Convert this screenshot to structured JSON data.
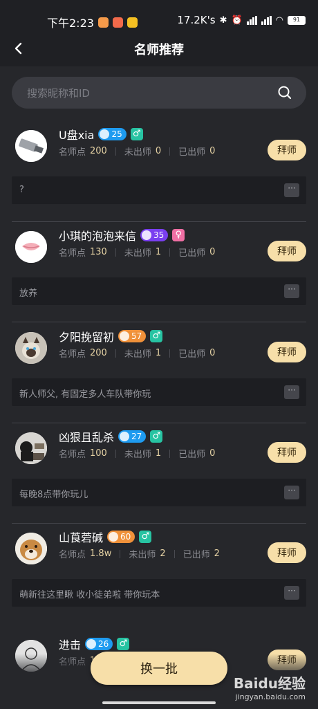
{
  "status_bar": {
    "time": "下午2:23",
    "net_speed": "17.2K's",
    "battery": "91",
    "apps": [
      "#f59a4a",
      "#f26a4b",
      "#f5c022"
    ]
  },
  "header": {
    "title": "名师推荐",
    "back_icon": "chevron-left-icon"
  },
  "search": {
    "placeholder": "搜索昵称和ID",
    "icon": "search-icon"
  },
  "colors": {
    "accent": "#f7dfa9",
    "badge_blue": "#1e9bf0",
    "badge_purple": "#7a3ff0",
    "badge_orange": "#f0913a",
    "male": "#27c3a2",
    "female": "#f06fa4"
  },
  "stat_labels": {
    "points": "名师点",
    "not_graduated": "未出师",
    "graduated": "已出师"
  },
  "masters": [
    {
      "name": "U盘xia",
      "level": "25",
      "level_color": "#1e9bf0",
      "gender": "♂",
      "gender_color": "#27c3a2",
      "points": "200",
      "not_graduated": "0",
      "graduated": "0",
      "button": "拜师",
      "intro": "?",
      "more": "···"
    },
    {
      "name": "小琪的泡泡来信",
      "level": "35",
      "level_color": "#7a3ff0",
      "gender": "♀",
      "gender_color": "#f06fa4",
      "points": "130",
      "not_graduated": "1",
      "graduated": "0",
      "button": "拜师",
      "intro": "放养",
      "more": "···"
    },
    {
      "name": "夕阳挽留初",
      "level": "57",
      "level_color": "#f0913a",
      "gender": "♂",
      "gender_color": "#27c3a2",
      "points": "200",
      "not_graduated": "1",
      "graduated": "0",
      "button": "拜师",
      "intro": "新人师父, 有固定多人车队带你玩",
      "more": "···"
    },
    {
      "name": "凶狠且乱杀",
      "level": "27",
      "level_color": "#1e9bf0",
      "gender": "♂",
      "gender_color": "#27c3a2",
      "points": "100",
      "not_graduated": "1",
      "graduated": "0",
      "button": "拜师",
      "intro": "每晚8点带你玩儿",
      "more": "···"
    },
    {
      "name": "山莨菪碱",
      "level": "60",
      "level_color": "#f0913a",
      "gender": "♂",
      "gender_color": "#27c3a2",
      "points": "1.8w",
      "not_graduated": "2",
      "graduated": "2",
      "button": "拜师",
      "intro": "萌新往这里瞅 收小徒弟啦 带你玩本",
      "more": "···"
    },
    {
      "name": "进击",
      "level": "26",
      "level_color": "#1e9bf0",
      "gender": "♂",
      "gender_color": "#27c3a2",
      "points": "1",
      "not_graduated": "",
      "graduated": "",
      "button": "拜师",
      "intro": "",
      "more": ""
    }
  ],
  "footer": {
    "refresh_label": "换一批"
  },
  "watermark": {
    "brand": "Baidu经验",
    "url": "jingyan.baidu.com"
  }
}
